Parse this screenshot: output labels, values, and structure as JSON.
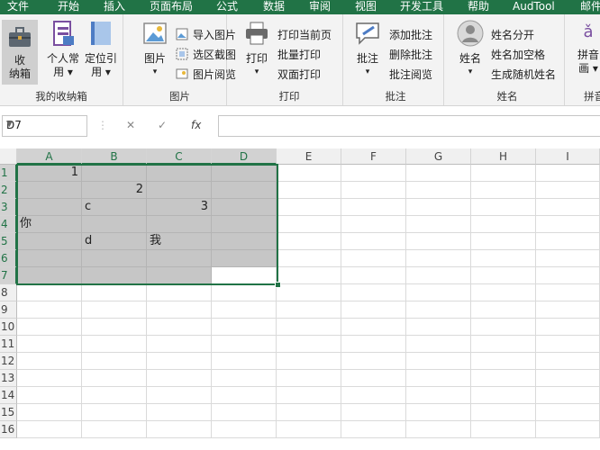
{
  "menu": [
    "文件",
    "开始",
    "插入",
    "页面布局",
    "公式",
    "数据",
    "审阅",
    "视图",
    "开发工具",
    "帮助",
    "AudTool",
    "邮件"
  ],
  "ribbon": {
    "group_storage": {
      "label": "我的收纳箱",
      "btn_storage": [
        "收",
        "纳箱"
      ],
      "btn_personal": [
        "个人常",
        "用 ▾"
      ],
      "btn_locate": [
        "定位引",
        "用 ▾"
      ]
    },
    "group_picture": {
      "label": "图片",
      "btn_picture": [
        "图片",
        "▾"
      ],
      "import": "导入图片",
      "crop": "选区截图",
      "browse": "图片阅览"
    },
    "group_print": {
      "label": "打印",
      "btn_print": [
        "打印",
        "▾"
      ],
      "current": "打印当前页",
      "batch": "批量打印",
      "duplex": "双面打印"
    },
    "group_comment": {
      "label": "批注",
      "btn_comment": [
        "批注",
        "▾"
      ],
      "add": "添加批注",
      "delete": "删除批注",
      "browse": "批注阅览"
    },
    "group_name": {
      "label": "姓名",
      "btn_name": [
        "姓名",
        "▾"
      ],
      "split": "姓名分开",
      "space": "姓名加空格",
      "random": "生成随机姓名"
    },
    "group_pinyin": {
      "label": "拼音",
      "btn_pinyin": [
        "拼音",
        "画 ▾"
      ]
    }
  },
  "formula_bar": {
    "name_box": "D7",
    "cancel": "✕",
    "confirm": "✓",
    "fx": "fx",
    "content": ""
  },
  "columns": [
    "A",
    "B",
    "C",
    "D",
    "E",
    "F",
    "G",
    "H",
    "I"
  ],
  "rows": [
    "1",
    "2",
    "3",
    "4",
    "5",
    "6",
    "7",
    "8",
    "9",
    "10",
    "11",
    "12",
    "13",
    "14",
    "15",
    "16"
  ],
  "cells": {
    "A1": "1",
    "B2": "2",
    "B3": "c",
    "C3": "3",
    "A4": "你",
    "B5": "d",
    "C5": "我"
  },
  "selection": "A1:D7",
  "active_cell": "D7",
  "colors": {
    "accent": "#217346",
    "selected_fill": "#c6c6c6"
  }
}
